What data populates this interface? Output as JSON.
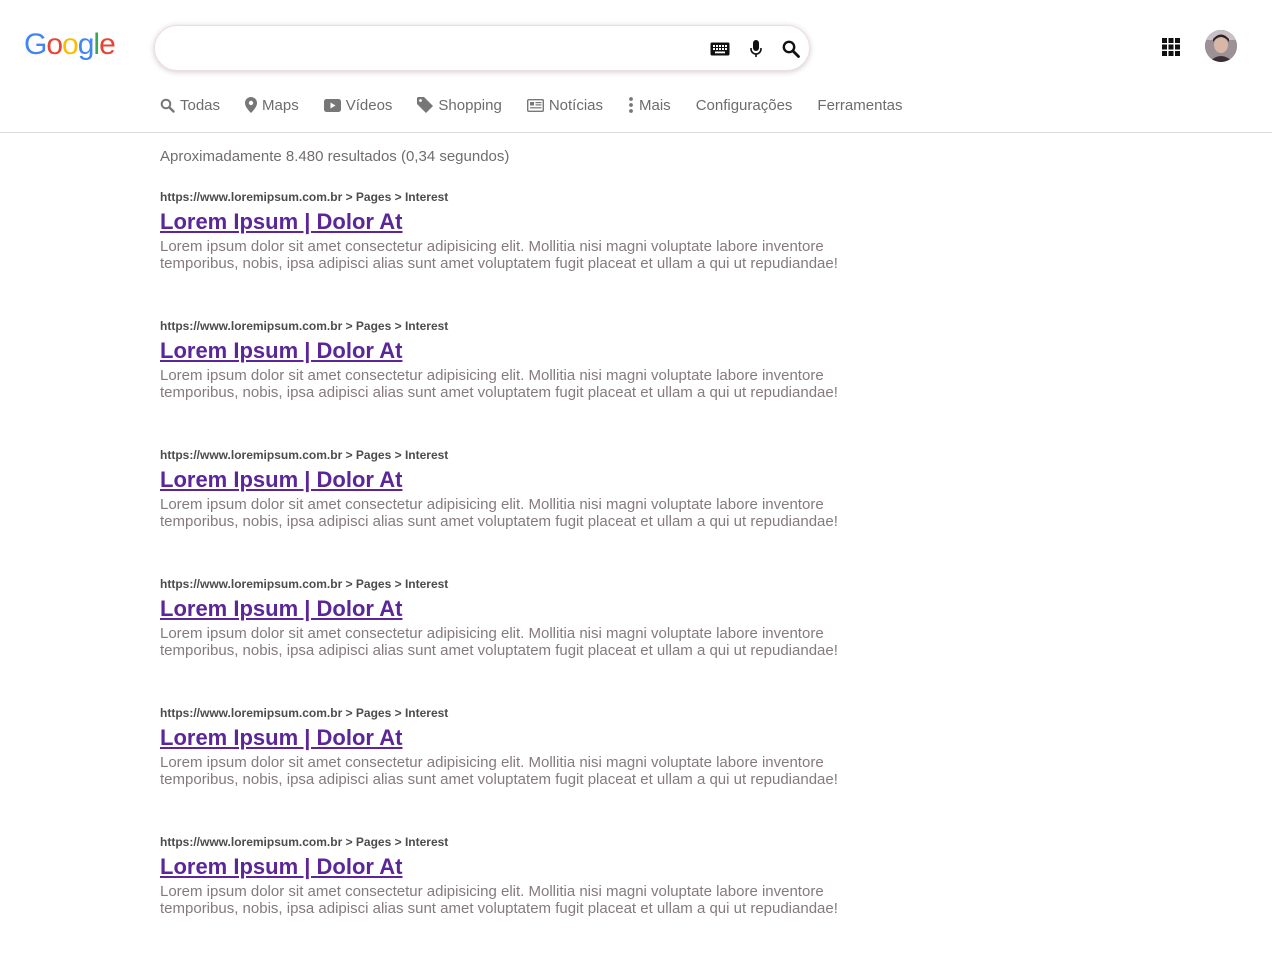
{
  "logo": {
    "letters": [
      "G",
      "o",
      "o",
      "g",
      "l",
      "e"
    ],
    "colors": [
      "#4285f4",
      "#ea4335",
      "#fbbc05",
      "#4285f4",
      "#34a853",
      "#ea4335"
    ]
  },
  "search": {
    "value": "",
    "placeholder": "",
    "icons": [
      "keyboard-icon",
      "microphone-icon",
      "search-icon"
    ]
  },
  "header": {
    "apps_icon": "apps-grid-icon",
    "avatar_icon": "user-avatar"
  },
  "tabs": [
    {
      "label": "Todas",
      "icon": "search-icon"
    },
    {
      "label": "Maps",
      "icon": "map-pin-icon"
    },
    {
      "label": "Vídeos",
      "icon": "video-icon"
    },
    {
      "label": "Shopping",
      "icon": "tag-icon"
    },
    {
      "label": "Notícias",
      "icon": "newspaper-icon"
    },
    {
      "label": "Mais",
      "icon": "more-vert-icon"
    },
    {
      "label": "Configurações",
      "icon": ""
    },
    {
      "label": "Ferramentas",
      "icon": ""
    }
  ],
  "stats": "Aproximadamente 8.480 resultados (0,34 segundos)",
  "results": [
    {
      "url": "https://www.loremipsum.com.br > Pages > Interest",
      "title": "Lorem Ipsum | Dolor At",
      "snippet": "Lorem ipsum dolor sit amet consectetur adipisicing elit. Mollitia nisi magni voluptate labore inventore temporibus, nobis, ipsa adipisci alias sunt amet voluptatem fugit placeat et ullam a qui ut repudiandae!"
    },
    {
      "url": "https://www.loremipsum.com.br > Pages > Interest",
      "title": "Lorem Ipsum | Dolor At",
      "snippet": "Lorem ipsum dolor sit amet consectetur adipisicing elit. Mollitia nisi magni voluptate labore inventore temporibus, nobis, ipsa adipisci alias sunt amet voluptatem fugit placeat et ullam a qui ut repudiandae!"
    },
    {
      "url": "https://www.loremipsum.com.br > Pages > Interest",
      "title": "Lorem Ipsum | Dolor At",
      "snippet": "Lorem ipsum dolor sit amet consectetur adipisicing elit. Mollitia nisi magni voluptate labore inventore temporibus, nobis, ipsa adipisci alias sunt amet voluptatem fugit placeat et ullam a qui ut repudiandae!"
    },
    {
      "url": "https://www.loremipsum.com.br > Pages > Interest",
      "title": "Lorem Ipsum | Dolor At",
      "snippet": "Lorem ipsum dolor sit amet consectetur adipisicing elit. Mollitia nisi magni voluptate labore inventore temporibus, nobis, ipsa adipisci alias sunt amet voluptatem fugit placeat et ullam a qui ut repudiandae!"
    },
    {
      "url": "https://www.loremipsum.com.br > Pages > Interest",
      "title": "Lorem Ipsum | Dolor At",
      "snippet": "Lorem ipsum dolor sit amet consectetur adipisicing elit. Mollitia nisi magni voluptate labore inventore temporibus, nobis, ipsa adipisci alias sunt amet voluptatem fugit placeat et ullam a qui ut repudiandae!"
    },
    {
      "url": "https://www.loremipsum.com.br > Pages > Interest",
      "title": "Lorem Ipsum | Dolor At",
      "snippet": "Lorem ipsum dolor sit amet consectetur adipisicing elit. Mollitia nisi magni voluptate labore inventore temporibus, nobis, ipsa adipisci alias sunt amet voluptatem fugit placeat et ullam a qui ut repudiandae!"
    }
  ],
  "colors": {
    "title_link": "#5b2697",
    "snippet": "#857a7e",
    "tab_text": "#6d6b6e"
  }
}
